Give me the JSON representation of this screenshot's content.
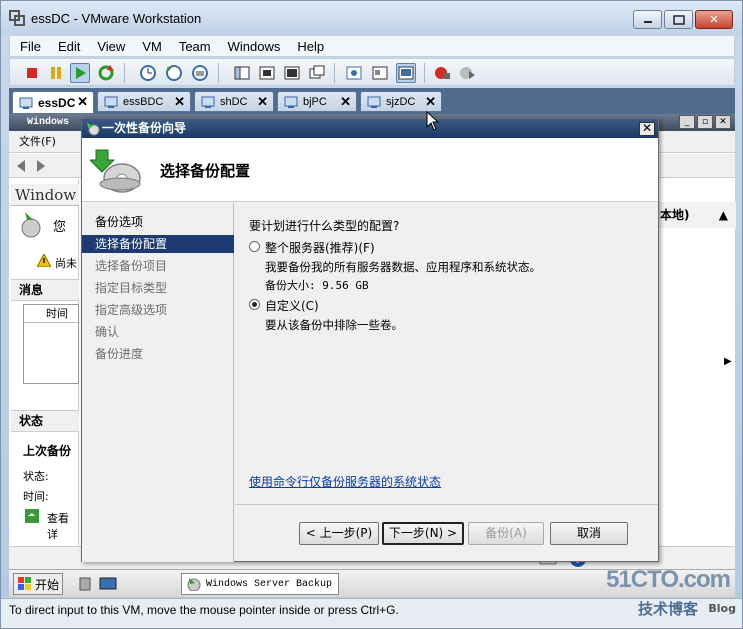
{
  "vmware": {
    "title": "essDC - VMware Workstation",
    "menu": [
      "File",
      "Edit",
      "View",
      "VM",
      "Team",
      "Windows",
      "Help"
    ],
    "tabs": [
      {
        "label": "essDC",
        "active": true
      },
      {
        "label": "essBDC",
        "active": false
      },
      {
        "label": "shDC",
        "active": false
      },
      {
        "label": "bjPC",
        "active": false
      },
      {
        "label": "sjzDC",
        "active": false
      }
    ],
    "status_text": "To direct input to this VM, move the mouse pointer inside or press Ctrl+G.",
    "watermark_1": "51CTO.com",
    "watermark_2": "技术博客",
    "watermark_3": "Blog"
  },
  "guest": {
    "window_title": "Windows",
    "menu_file": "文件(F)",
    "left_header": "Window",
    "left_text": "您",
    "warning_text": "尚未",
    "messages_title": "消息",
    "grid_col": "时间",
    "status_title": "状态",
    "last_backup": "上次备份",
    "status_label": "状态:",
    "time_label": "时间:",
    "view_details": "查看详",
    "right_header": "本地)",
    "taskbar": {
      "start": "开始",
      "task": "Windows Server Backup"
    }
  },
  "wizard": {
    "title": "一次性备份向导",
    "header": "选择备份配置",
    "nav": [
      {
        "label": "备份选项",
        "state": "done"
      },
      {
        "label": "选择备份配置",
        "state": "current"
      },
      {
        "label": "选择备份项目",
        "state": "pending"
      },
      {
        "label": "指定目标类型",
        "state": "pending"
      },
      {
        "label": "指定高级选项",
        "state": "pending"
      },
      {
        "label": "确认",
        "state": "pending"
      },
      {
        "label": "备份进度",
        "state": "pending"
      }
    ],
    "question": "要计划进行什么类型的配置?",
    "option_full": {
      "label": "整个服务器(推荐)(F)",
      "desc": "我要备份我的所有服务器数据、应用程序和系统状态。",
      "size": "备份大小: 9.56 GB",
      "selected": false
    },
    "option_custom": {
      "label": "自定义(C)",
      "desc": "要从该备份中排除一些卷。",
      "selected": true
    },
    "cmd_link": "使用命令行仅备份服务器的系统状态",
    "buttons": {
      "back": "< 上一步(P)",
      "next": "下一步(N) >",
      "backup": "备份(A)",
      "cancel": "取消"
    }
  }
}
